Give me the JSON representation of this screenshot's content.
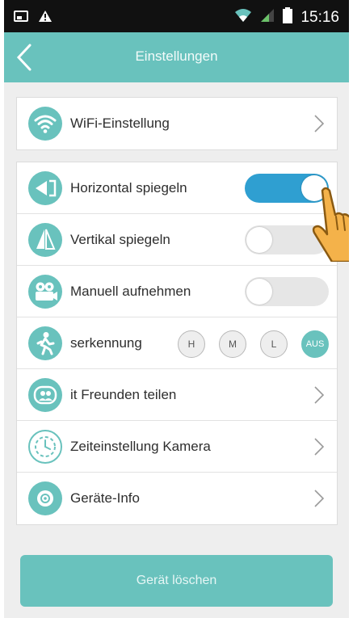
{
  "status_bar": {
    "time": "15:16",
    "icons": [
      "sim-icon",
      "warning-icon",
      "wifi-icon",
      "signal-icon",
      "battery-icon"
    ]
  },
  "header": {
    "title": "Einstellungen",
    "back_icon": "chevron-left-icon"
  },
  "groups": {
    "wifi": {
      "label": "WiFi-Einstellung",
      "icon": "wifi-icon"
    },
    "settings": [
      {
        "label": "Horizontal spiegeln",
        "icon": "mirror-horizontal-icon",
        "control": "toggle",
        "state": "on"
      },
      {
        "label": "Vertikal spiegeln",
        "icon": "mirror-vertical-icon",
        "control": "toggle",
        "state": "off"
      },
      {
        "label": "Manuell aufnehmen",
        "icon": "camera-icon",
        "control": "toggle",
        "state": "off"
      },
      {
        "label": "serkennung",
        "icon": "motion-person-icon",
        "control": "chips",
        "chips": [
          "H",
          "M",
          "L",
          "AUS"
        ],
        "selected": "AUS"
      },
      {
        "label": "it Freunden teilen",
        "icon": "share-friends-icon",
        "control": "chevron"
      },
      {
        "label": "Zeiteinstellung Kamera",
        "icon": "clock-icon",
        "control": "chevron"
      },
      {
        "label": "Geräte-Info",
        "icon": "info-icon",
        "control": "chevron"
      }
    ]
  },
  "delete_button": {
    "label": "Gerät löschen"
  },
  "colors": {
    "accent": "#69c2bd",
    "toggle_on": "#2f9fd1",
    "status_bar": "#111111",
    "background": "#eeeeee"
  }
}
